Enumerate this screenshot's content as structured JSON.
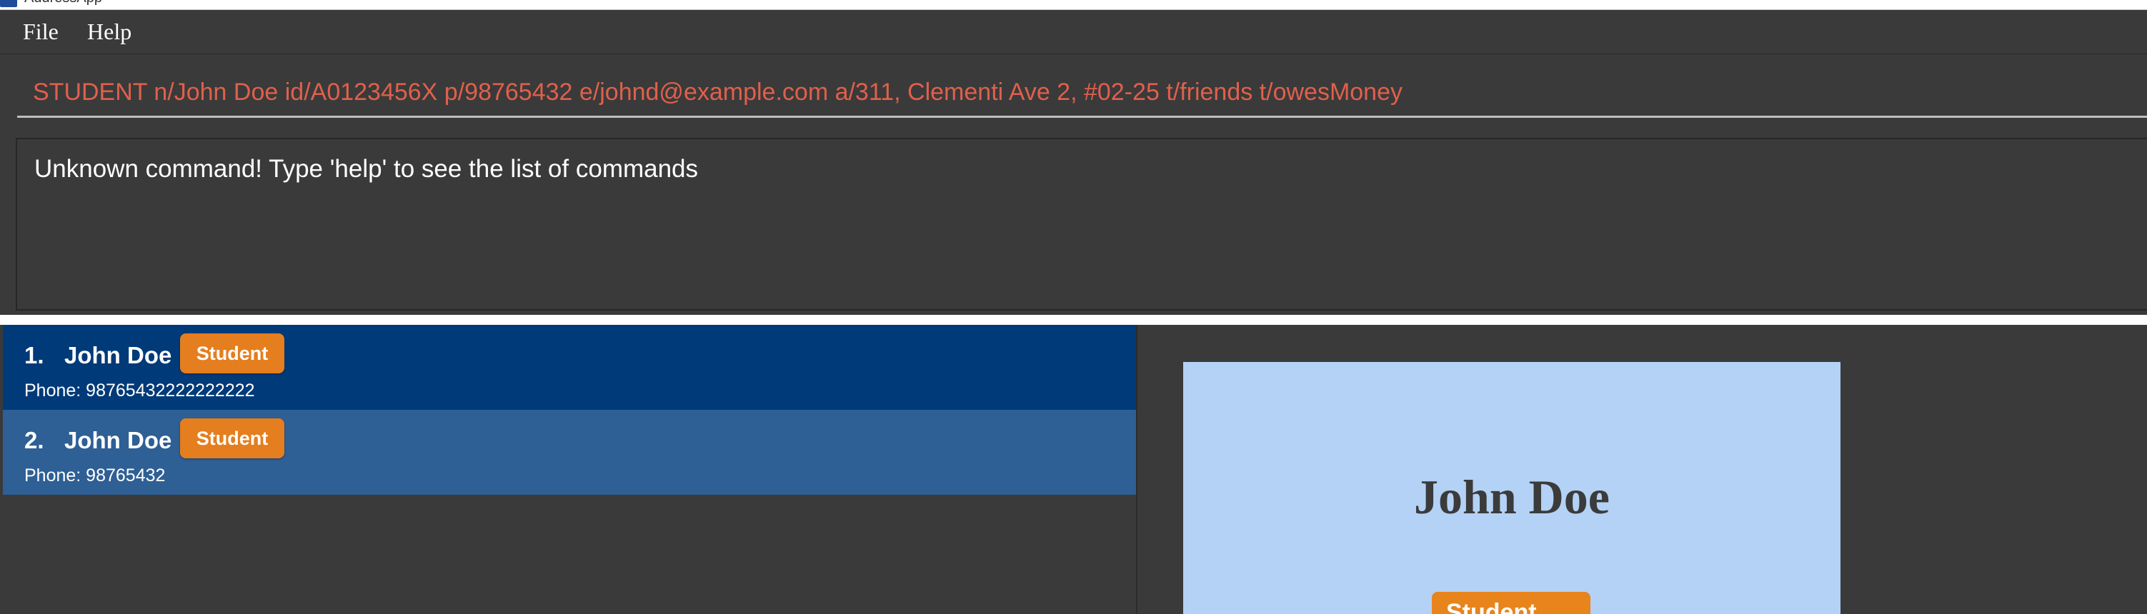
{
  "window": {
    "title": "AddressApp",
    "icon": "app-logo-icon",
    "accent_color": "#1f4c9a"
  },
  "menubar": {
    "items": [
      {
        "label": "File"
      },
      {
        "label": "Help"
      }
    ]
  },
  "command_box": {
    "value": "STUDENT n/John Doe id/A0123456X p/98765432 e/johnd@example.com a/311, Clementi Ave 2, #02-25 t/friends t/owesMoney",
    "error_color": "#e0604c"
  },
  "result_display": {
    "text": "Unknown command! Type 'help' to see the list of commands"
  },
  "person_list": [
    {
      "index": "1.",
      "name": "John Doe",
      "tag": "Student",
      "phone": "Phone: 98765432222222222",
      "selected": true
    },
    {
      "index": "2.",
      "name": "John Doe",
      "tag": "Student",
      "phone": "Phone: 98765432",
      "selected": false
    }
  ],
  "detail": {
    "name": "John Doe",
    "tag": "Student"
  },
  "colors": {
    "background": "#383838",
    "selected_card": "#003a78",
    "card": "#2e5f95",
    "tag": "#e57e1e",
    "detail_card": "#b3d2f5"
  }
}
